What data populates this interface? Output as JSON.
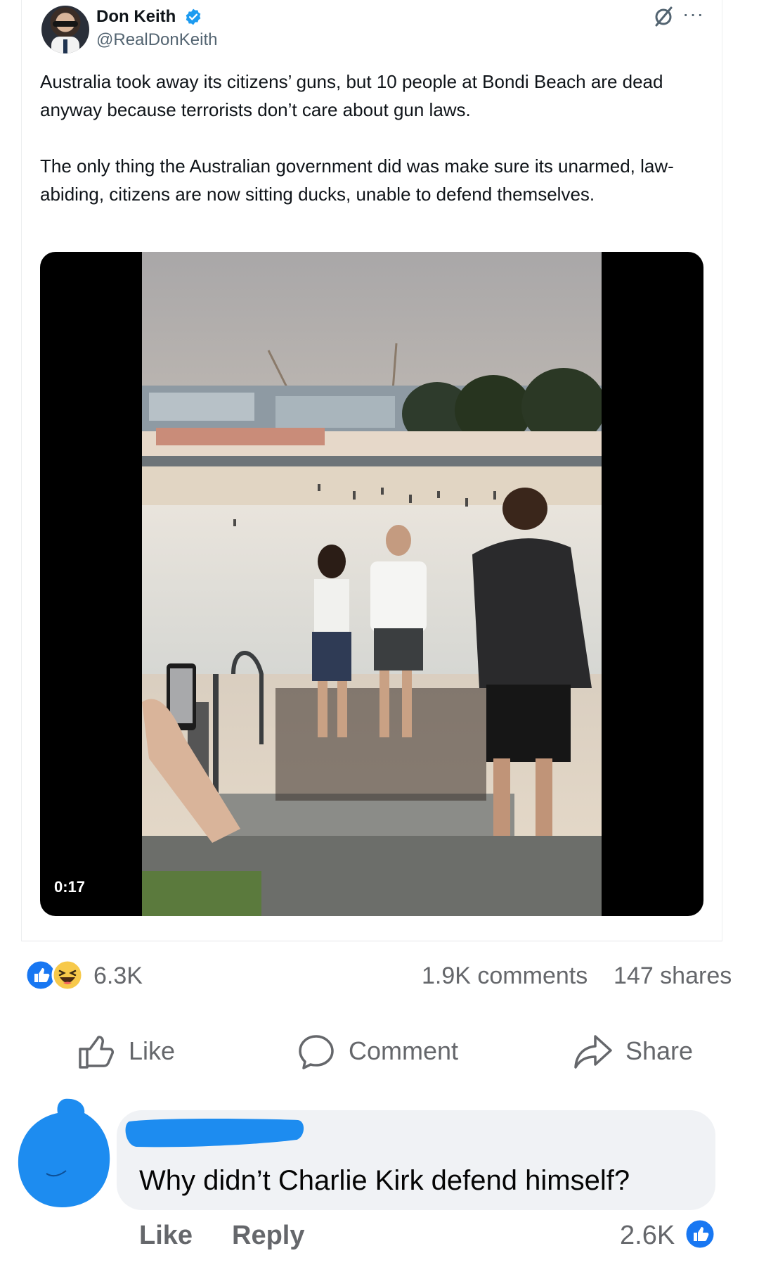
{
  "tweet": {
    "author_name": "Don Keith",
    "author_handle": "@RealDonKeith",
    "verified_icon": "verified-badge-icon",
    "paragraphs": [
      "Australia took away its citizens’ guns, but 10 people at Bondi Beach are dead anyway because terrorists don’t care about gun laws.",
      "The only thing the Australian government did was make sure its unarmed, law-abiding, citizens are now sitting ducks, unable to defend themselves."
    ],
    "video": {
      "duration": "0:17"
    }
  },
  "post_stats": {
    "reaction_icons": [
      "like-reaction-icon",
      "haha-reaction-icon"
    ],
    "reaction_count": "6.3K",
    "comments": "1.9K comments",
    "shares": "147 shares"
  },
  "actions": {
    "like": "Like",
    "comment": "Comment",
    "share": "Share"
  },
  "comment": {
    "text": "Why didn’t Charlie Kirk defend himself?",
    "like_label": "Like",
    "reply_label": "Reply",
    "like_count": "2.6K"
  },
  "colors": {
    "facebook_blue": "#1877f2",
    "haha_yellow": "#f7c94a",
    "redaction_blue": "#1d8cf0",
    "secondary_text": "#65676b",
    "bubble_bg": "#f0f2f5"
  }
}
